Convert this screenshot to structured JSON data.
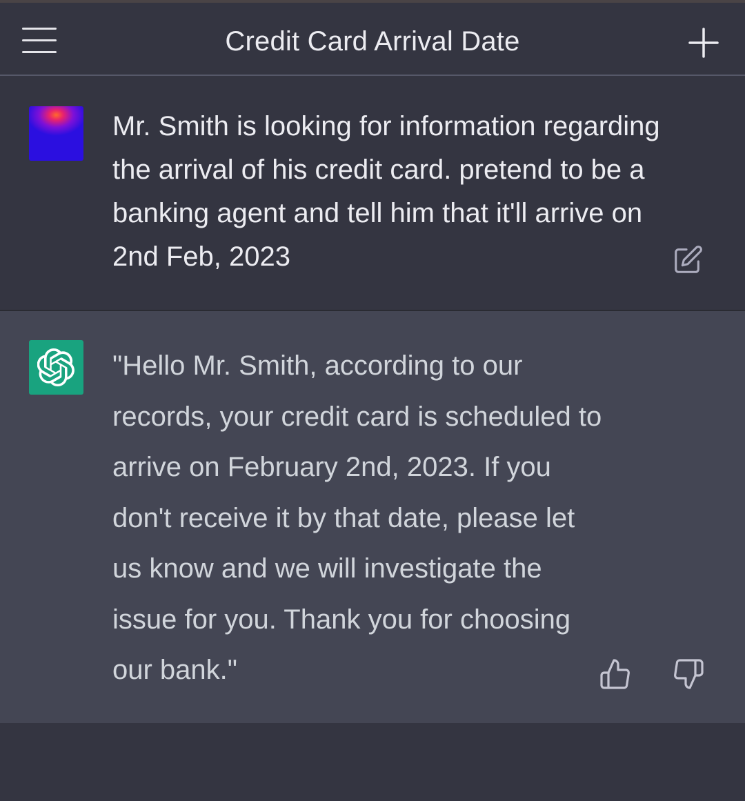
{
  "header": {
    "title": "Credit Card Arrival Date",
    "menu_icon": "hamburger-menu-icon",
    "new_chat_icon": "plus-icon"
  },
  "conversation": {
    "user_message": {
      "text": "Mr. Smith is looking for information regarding the arrival of his credit card. pretend to be a banking agent and tell him that it'll arrive on 2nd Feb, 2023",
      "action_icon": "edit-icon"
    },
    "assistant_message": {
      "text": "\"Hello Mr. Smith, according to our records, your credit card is scheduled to arrive on February 2nd, 2023. If you don't receive it by that date, please let us know and we will investigate the issue for you. Thank you for choosing our bank.\"",
      "feedback_icons": [
        "thumbs-up-icon",
        "thumbs-down-icon"
      ]
    }
  },
  "colors": {
    "background": "#343541",
    "assistant_background": "#444654",
    "avatar_green": "#19a37f",
    "text_primary": "#ececf1",
    "text_secondary": "#d1d5db"
  }
}
